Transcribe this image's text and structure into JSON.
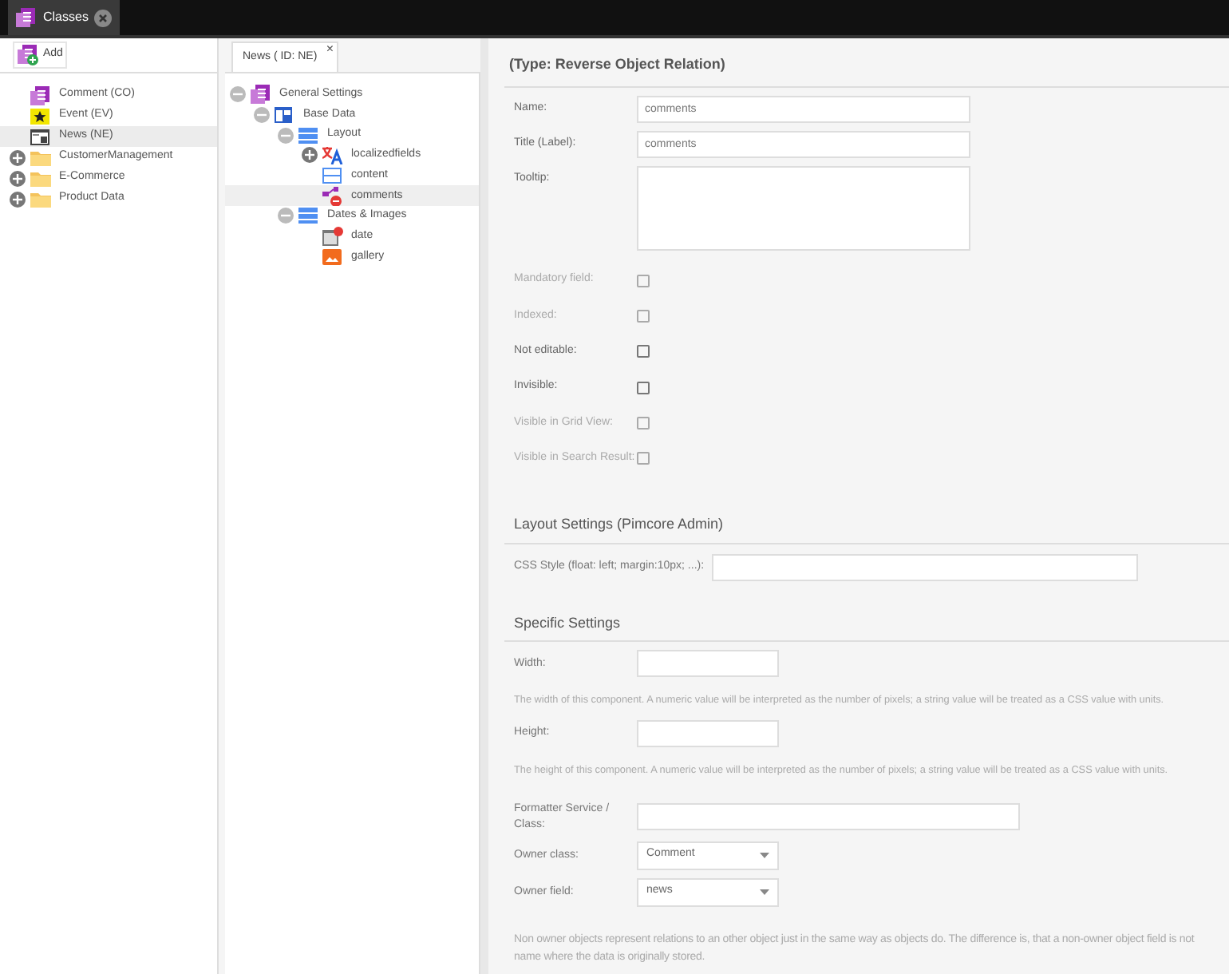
{
  "top_tabs": [
    {
      "label": "Classes",
      "selected": true
    }
  ],
  "left_panel": {
    "add_button": "Add",
    "items": [
      {
        "label": "Comment (CO)",
        "kind": "comment",
        "selected": false
      },
      {
        "label": "Event (EV)",
        "kind": "event",
        "selected": false
      },
      {
        "label": "News (NE)",
        "kind": "news",
        "selected": true
      },
      {
        "label": "CustomerManagement",
        "kind": "folder",
        "expanded": false,
        "selected": false
      },
      {
        "label": "E-Commerce",
        "kind": "folder",
        "expanded": false,
        "selected": false
      },
      {
        "label": "Product Data",
        "kind": "folder",
        "expanded": false,
        "selected": false
      }
    ]
  },
  "editor_tab": {
    "label": "News ( ID: NE)",
    "close": "×"
  },
  "tree": [
    {
      "label": "General Settings",
      "kind": "class",
      "expanded": true,
      "selected": false,
      "children": [
        {
          "label": "Base Data",
          "kind": "panel",
          "expanded": true,
          "selected": false,
          "children": [
            {
              "label": "Layout",
              "kind": "region",
              "expanded": true,
              "selected": false,
              "children": [
                {
                  "label": "localizedfields",
                  "kind": "translate",
                  "expanded": false,
                  "selected": false
                },
                {
                  "label": "content",
                  "kind": "fieldset",
                  "selected": false
                },
                {
                  "label": "comments",
                  "kind": "relation",
                  "selected": true
                }
              ]
            },
            {
              "label": "Dates & Images",
              "kind": "region",
              "expanded": true,
              "selected": false,
              "children": [
                {
                  "label": "date",
                  "kind": "date",
                  "selected": false
                },
                {
                  "label": "gallery",
                  "kind": "gallery",
                  "selected": false
                }
              ]
            }
          ]
        }
      ]
    }
  ],
  "form": {
    "title": "(Type: Reverse Object Relation)",
    "fields": [
      {
        "label": "Name:",
        "kind": "text",
        "value": "comments"
      },
      {
        "label": "Title (Label):",
        "kind": "text",
        "value": "comments"
      },
      {
        "label": "Tooltip:",
        "kind": "textarea"
      }
    ],
    "checkboxes": [
      {
        "label": "Mandatory field:",
        "checked": false,
        "disabled": true
      },
      {
        "label": "Indexed:",
        "checked": false,
        "disabled": true
      },
      {
        "label": "Not editable:",
        "checked": false,
        "disabled": false
      },
      {
        "label": "Invisible:",
        "checked": false,
        "disabled": false
      },
      {
        "label": "Visible in Grid View:",
        "checked": false,
        "disabled": true
      },
      {
        "label": "Visible in Search Result:",
        "checked": false,
        "disabled": true
      }
    ],
    "layout_settings": {
      "title": "Layout Settings (Pimcore Admin)",
      "css_label": "CSS Style (float: left; margin:10px; ...):"
    },
    "specific_settings": {
      "title": "Specific Settings",
      "fields": [
        {
          "label": "Width:",
          "kind": "short",
          "help": "The width of this component. A numeric value will be interpreted as the number of pixels; a string value will be treated as a CSS value with units."
        },
        {
          "label": "Height:",
          "kind": "short",
          "help": "The height of this component. A numeric value will be interpreted as the number of pixels; a string value will be treated as a CSS value with units."
        },
        {
          "label": "Formatter Service / Class:",
          "kind": "long"
        },
        {
          "label": "Owner class:",
          "kind": "select",
          "value": "Comment"
        },
        {
          "label": "Owner field:",
          "kind": "select",
          "value": "news"
        }
      ],
      "note_lines": [
        "Non owner objects represent relations to an other object just in the same way as objects do. The difference is, that a non-owner object field is not",
        "name where the data is originally stored."
      ]
    }
  }
}
